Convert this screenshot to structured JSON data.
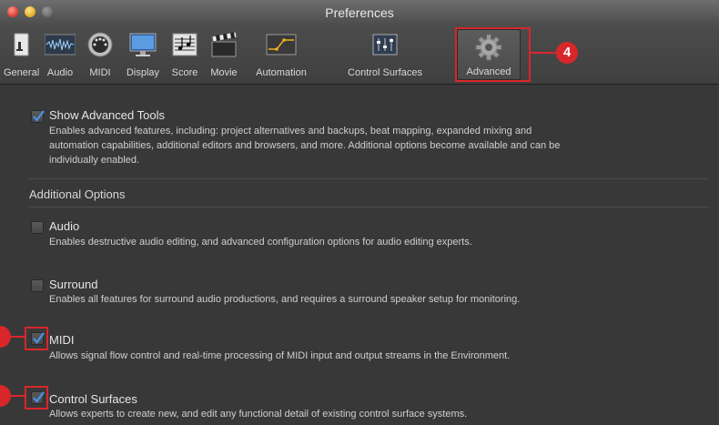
{
  "window": {
    "title": "Preferences"
  },
  "toolbar": {
    "items": [
      {
        "label": "General",
        "icon": "general-icon"
      },
      {
        "label": "Audio",
        "icon": "audio-icon"
      },
      {
        "label": "MIDI",
        "icon": "midi-icon"
      },
      {
        "label": "Display",
        "icon": "display-icon"
      },
      {
        "label": "Score",
        "icon": "score-icon"
      },
      {
        "label": "Movie",
        "icon": "movie-icon"
      },
      {
        "label": "Automation",
        "icon": "automation-icon"
      },
      {
        "label": "Control Surfaces",
        "icon": "control-surfaces-icon"
      },
      {
        "label": "Advanced",
        "icon": "gear-icon",
        "selected": true
      }
    ]
  },
  "callouts": {
    "advanced": "4",
    "midi": "",
    "control_surfaces": ""
  },
  "show_advanced": {
    "title": "Show Advanced Tools",
    "checked": true,
    "desc_line1": "Enables advanced features, including: project alternatives and backups, beat mapping, expanded mixing and",
    "desc_line2": "automation capabilities, additional editors and browsers, and more. Additional options become available and can be",
    "desc_line3": "individually enabled."
  },
  "additional_options": {
    "heading": "Additional Options",
    "options": [
      {
        "title": "Audio",
        "checked": false,
        "desc": "Enables destructive audio editing, and advanced configuration options for audio editing experts."
      },
      {
        "title": "Surround",
        "checked": false,
        "desc": "Enables all features for surround audio productions, and requires a surround speaker setup for monitoring."
      },
      {
        "title": "MIDI",
        "checked": true,
        "desc": "Allows signal flow control and real-time processing of MIDI input and output streams in the Environment."
      },
      {
        "title": "Control Surfaces",
        "checked": true,
        "desc": "Allows experts to create new, and edit any functional detail of existing control surface systems."
      }
    ]
  },
  "colors": {
    "accent": "#d8262a",
    "check": "#4a8fe0",
    "background": "#383838"
  }
}
